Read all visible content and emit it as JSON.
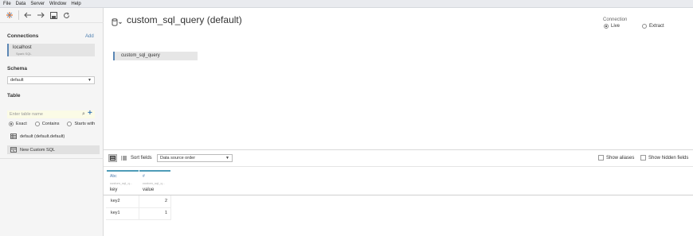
{
  "menu": [
    "File",
    "Data",
    "Server",
    "Window",
    "Help"
  ],
  "sidebar": {
    "connections_title": "Connections",
    "add_label": "Add",
    "connection": {
      "name": "localhost",
      "type": "Spark SQL"
    },
    "schema_title": "Schema",
    "schema_value": "default",
    "table_title": "Table",
    "table_placeholder": "Enter table name",
    "match_options": [
      "Exact",
      "Contains",
      "Starts with"
    ],
    "tables": [
      "default (default.default)"
    ],
    "new_custom_sql": "New Custom SQL"
  },
  "main": {
    "datasource_title": "custom_sql_query (default)",
    "connection_label": "Connection",
    "connection_options": [
      "Live",
      "Extract"
    ],
    "canvas_table": "custom_sql_query"
  },
  "grid": {
    "sort_label": "Sort fields",
    "sort_value": "Data source order",
    "show_aliases": "Show aliases",
    "show_hidden": "Show hidden fields",
    "columns": [
      {
        "type": "Abc",
        "source": "custom_sql_q...",
        "name": "key"
      },
      {
        "type": "#",
        "source": "custom_sql_q...",
        "name": "value"
      }
    ],
    "rows": [
      [
        "key2",
        "2"
      ],
      [
        "key1",
        "1"
      ]
    ]
  },
  "colors": {
    "accent": "#4e9cb8",
    "connection_bar": "#5b87b5",
    "background": "#ffffff"
  }
}
